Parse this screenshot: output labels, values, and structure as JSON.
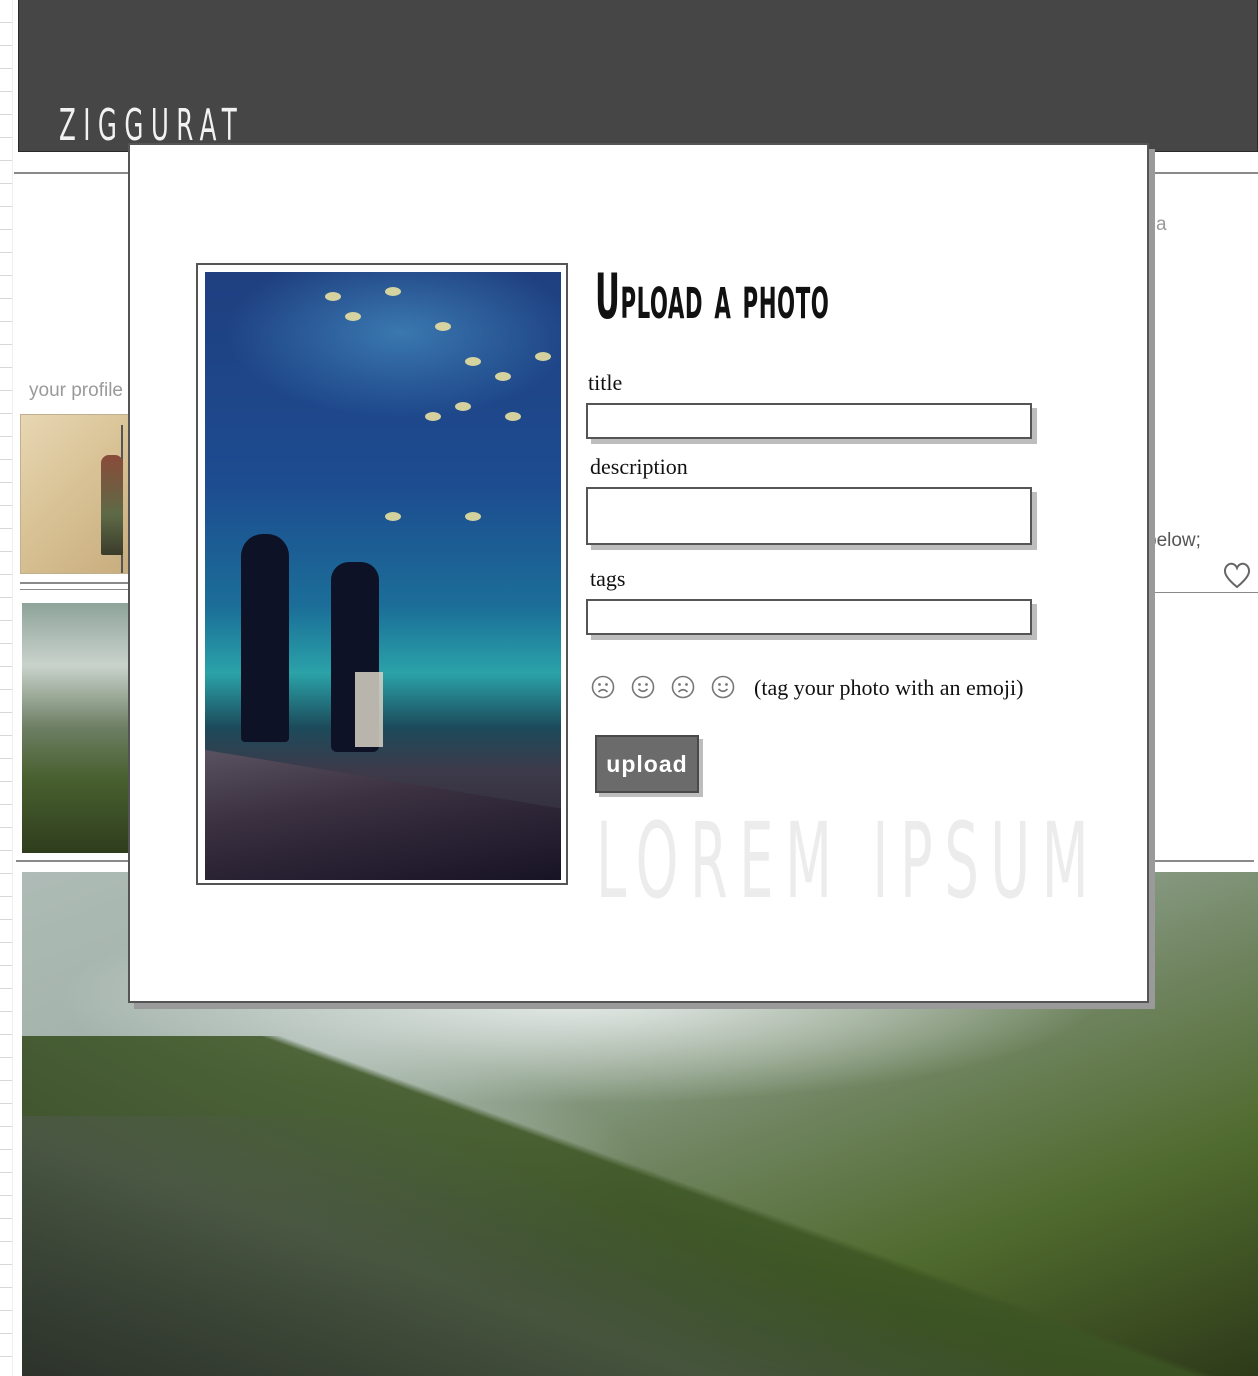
{
  "app": {
    "logo": "Ziggurat"
  },
  "background": {
    "profile_label": "your profile",
    "fragment_a": "a",
    "fragment_below": "below;"
  },
  "modal": {
    "title": "Upload a photo",
    "fields": {
      "title_label": "title",
      "title_value": "",
      "description_label": "description",
      "description_value": "",
      "tags_label": "tags",
      "tags_value": ""
    },
    "emoji": {
      "icons": [
        "frown-face-icon",
        "smile-face-icon",
        "frown-face-icon",
        "smile-face-icon"
      ],
      "hint": "(tag your photo with an emoji)"
    },
    "upload_label": "upload",
    "watermark": "Lorem ipsum"
  },
  "colors": {
    "header_bg": "#464646",
    "button_bg": "#6b6b6b",
    "border": "#555555"
  }
}
